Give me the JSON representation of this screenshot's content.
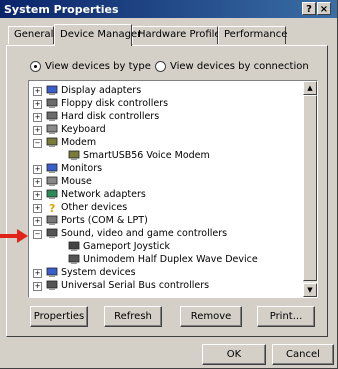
{
  "window": {
    "title": "System Properties",
    "help_label": "?",
    "close_label": "×"
  },
  "tabs": [
    "General",
    "Device Manager",
    "Hardware Profiles",
    "Performance"
  ],
  "active_tab": "Device Manager",
  "view": {
    "by_type": "View devices by type",
    "by_connection": "View devices by connection",
    "selected": "by_type"
  },
  "tree": [
    {
      "label": "Display adapters",
      "icon": "display-adapter-icon",
      "expander": "+"
    },
    {
      "label": "Floppy disk controllers",
      "icon": "floppy-controller-icon",
      "expander": "+"
    },
    {
      "label": "Hard disk controllers",
      "icon": "hard-disk-controller-icon",
      "expander": "+"
    },
    {
      "label": "Keyboard",
      "icon": "keyboard-icon",
      "expander": "+"
    },
    {
      "label": "Modem",
      "icon": "modem-icon",
      "expander": "−"
    },
    {
      "label": "SmartUSB56 Voice Modem",
      "icon": "modem-icon",
      "expander": "",
      "child": true
    },
    {
      "label": "Monitors",
      "icon": "monitor-icon",
      "expander": "+"
    },
    {
      "label": "Mouse",
      "icon": "mouse-icon",
      "expander": "+"
    },
    {
      "label": "Network adapters",
      "icon": "network-adapter-icon",
      "expander": "+"
    },
    {
      "label": "Other devices",
      "icon": "question-mark-icon",
      "expander": "+"
    },
    {
      "label": "Ports (COM & LPT)",
      "icon": "port-icon",
      "expander": "+"
    },
    {
      "label": "Sound, video and game controllers",
      "icon": "sound-controller-icon",
      "expander": "−"
    },
    {
      "label": "Gameport Joystick",
      "icon": "joystick-icon",
      "expander": "",
      "child": true
    },
    {
      "label": "Unimodem Half Duplex Wave Device",
      "icon": "sound-controller-icon",
      "expander": "",
      "child": true
    },
    {
      "label": "System devices",
      "icon": "computer-icon",
      "expander": "+"
    },
    {
      "label": "Universal Serial Bus controllers",
      "icon": "usb-icon",
      "expander": "+"
    }
  ],
  "buttons": {
    "properties": "Properties",
    "refresh": "Refresh",
    "remove": "Remove",
    "print": "Print...",
    "ok": "OK",
    "cancel": "Cancel"
  },
  "colors": {
    "titlebar": "#0a246a",
    "arrow": "#e2231a"
  }
}
